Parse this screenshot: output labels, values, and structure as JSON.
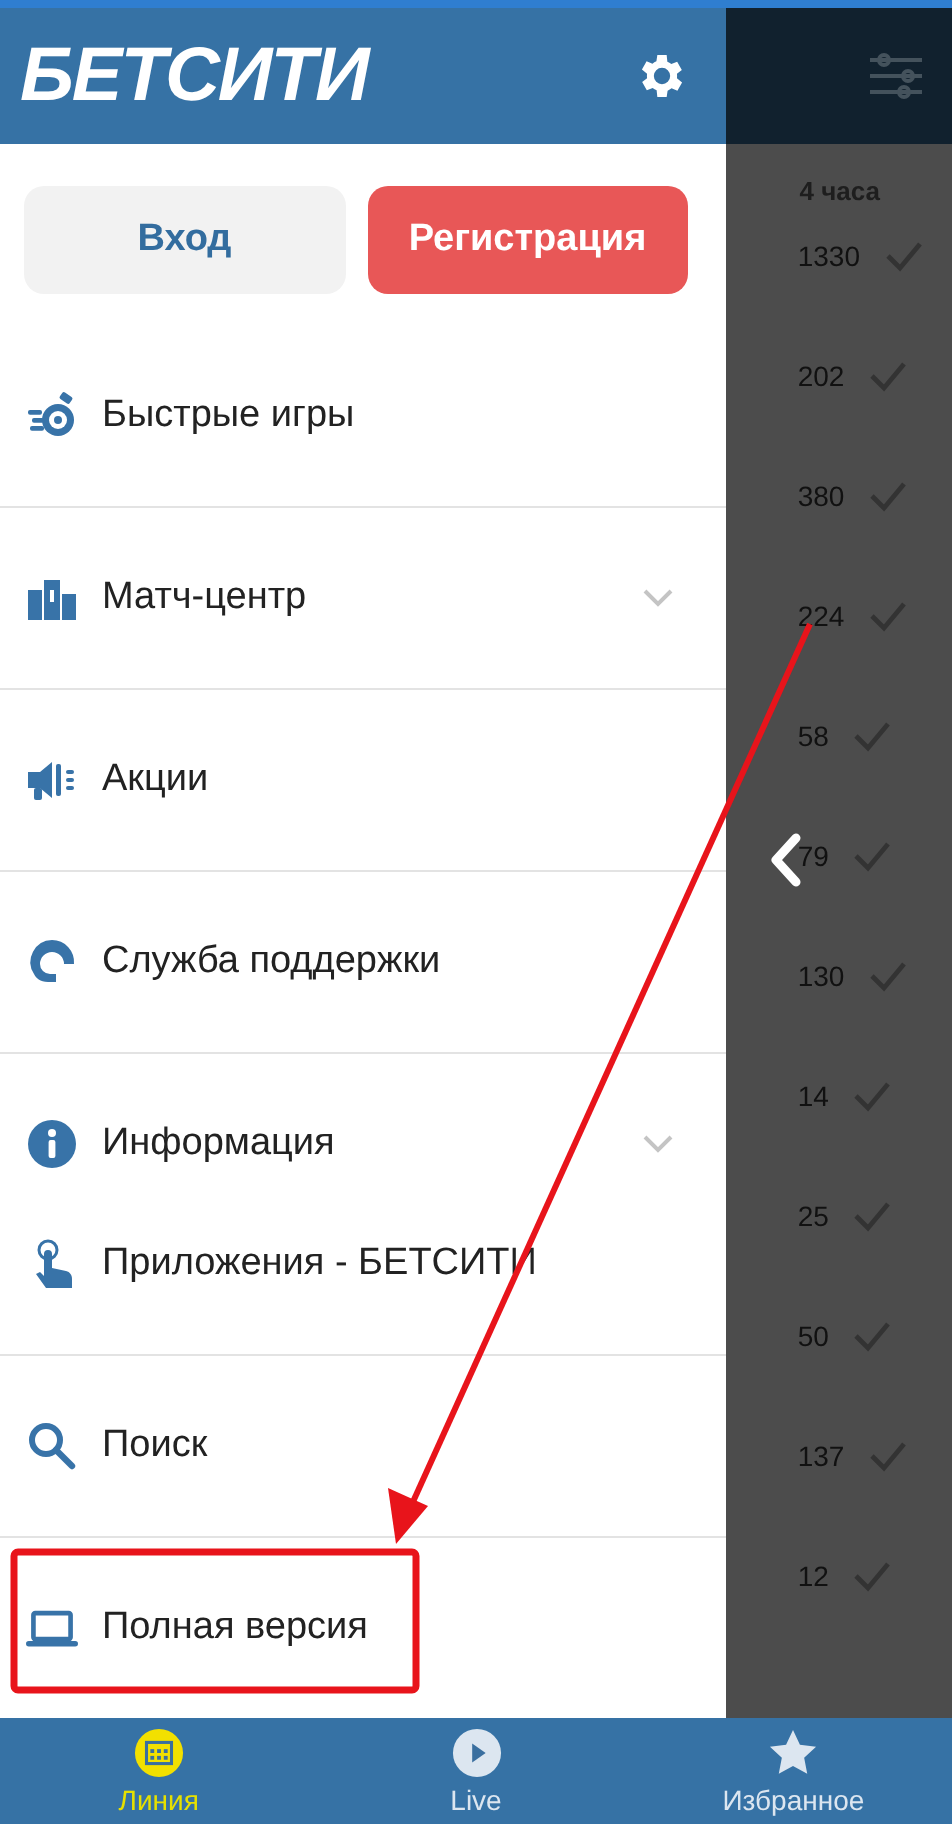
{
  "drawer": {
    "logo": "БЕТСИТИ",
    "buttons": [
      {
        "label": "Вход",
        "kind": "secondary"
      },
      {
        "label": "Регистрация",
        "kind": "primary"
      }
    ],
    "sections": [
      [
        {
          "label": "Быстрые игры",
          "expandable": false
        }
      ],
      [
        {
          "label": "Матч-центр",
          "expandable": true
        }
      ],
      [
        {
          "label": "Акции",
          "expandable": false
        }
      ],
      [
        {
          "label": "Служба поддержки",
          "expandable": false
        }
      ],
      [
        {
          "label": "Информация",
          "expandable": true
        },
        {
          "label": "Приложения - БЕТСИТИ",
          "expandable": false
        }
      ],
      [
        {
          "label": "Поиск",
          "expandable": false
        }
      ],
      [
        {
          "label": "Полная версия",
          "expandable": false
        }
      ]
    ]
  },
  "background": {
    "time_header": "4 часа",
    "counts": [
      "1330",
      "202",
      "380",
      "224",
      "58",
      "79",
      "130",
      "14",
      "25",
      "50",
      "137",
      "12"
    ]
  },
  "bottom_nav": [
    {
      "label": "Линия",
      "selected": true
    },
    {
      "label": "Live",
      "selected": false
    },
    {
      "label": "Избранное",
      "selected": false
    }
  ]
}
